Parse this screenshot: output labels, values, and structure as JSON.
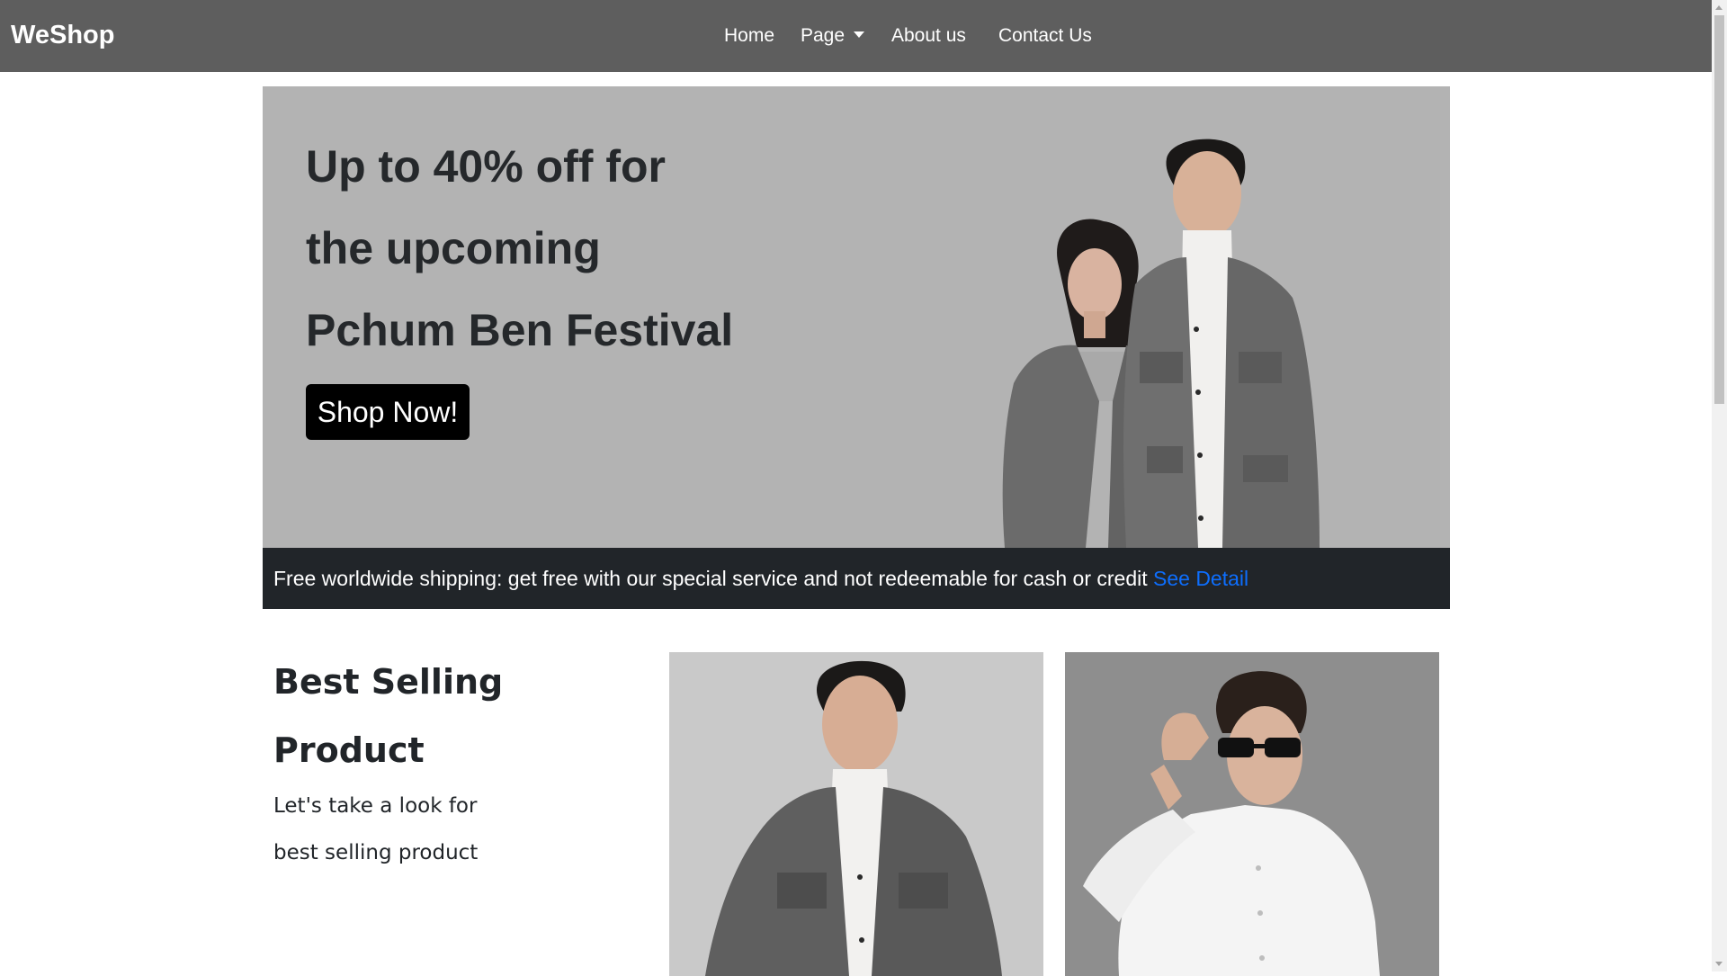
{
  "navbar": {
    "brand": "WeShop",
    "items": [
      {
        "label": "Home"
      },
      {
        "label": "Page"
      },
      {
        "label": "About us"
      },
      {
        "label": "Contact Us"
      }
    ]
  },
  "hero": {
    "heading_lines": [
      "Up to 40% off for",
      "the upcoming",
      "Pchum Ben Festival"
    ],
    "cta_label": "Shop Now!",
    "image_icon": "couple-in-grey-coats-photo"
  },
  "shipping": {
    "text": "Free worldwide shipping: get free with our special service and not redeemable for cash or credit ",
    "link_label": "See Detail"
  },
  "best_selling": {
    "title_lines": [
      "Best Selling",
      "Product"
    ],
    "subtitle_lines": [
      "Let's take a look for",
      "best selling product"
    ],
    "products": [
      {
        "image_icon": "man-grey-jacket-photo"
      },
      {
        "image_icon": "man-sunglasses-white-shirt-photo"
      }
    ]
  },
  "colors": {
    "navbar_bg": "#5e5e5e",
    "hero_bg": "#b3b3b3",
    "shipping_bg": "#212529",
    "link": "#0d6efd",
    "cta_bg": "#000000"
  }
}
